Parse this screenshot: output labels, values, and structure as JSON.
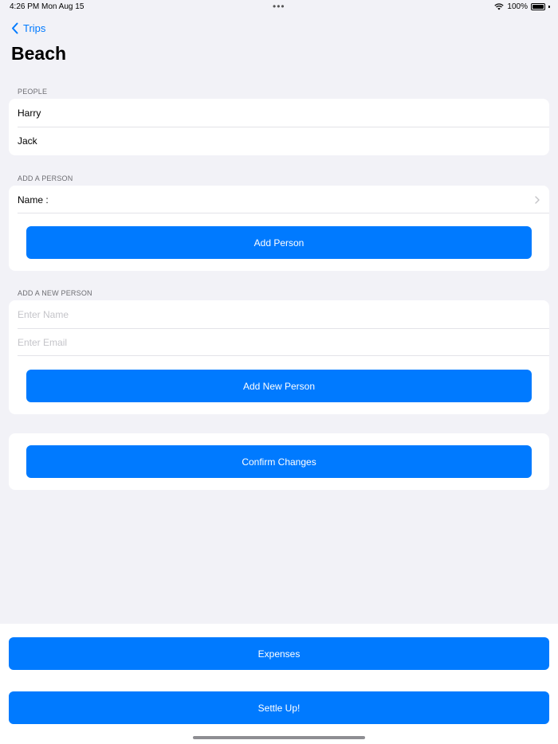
{
  "status_bar": {
    "time": "4:26 PM",
    "date": "Mon Aug 15",
    "battery": "100%"
  },
  "nav": {
    "back_label": "Trips",
    "title": "Beach"
  },
  "people_section": {
    "header": "PEOPLE",
    "people": [
      "Harry",
      "Jack"
    ]
  },
  "add_person_section": {
    "header": "ADD A PERSON",
    "name_label": "Name :",
    "button_label": "Add Person"
  },
  "add_new_person_section": {
    "header": "ADD A NEW PERSON",
    "name_placeholder": "Enter Name",
    "email_placeholder": "Enter Email",
    "button_label": "Add New Person"
  },
  "confirm": {
    "button_label": "Confirm Changes"
  },
  "bottom": {
    "expenses_label": "Expenses",
    "settle_label": "Settle Up!"
  },
  "colors": {
    "accent": "#007aff",
    "background": "#f2f2f7",
    "card": "#ffffff"
  }
}
